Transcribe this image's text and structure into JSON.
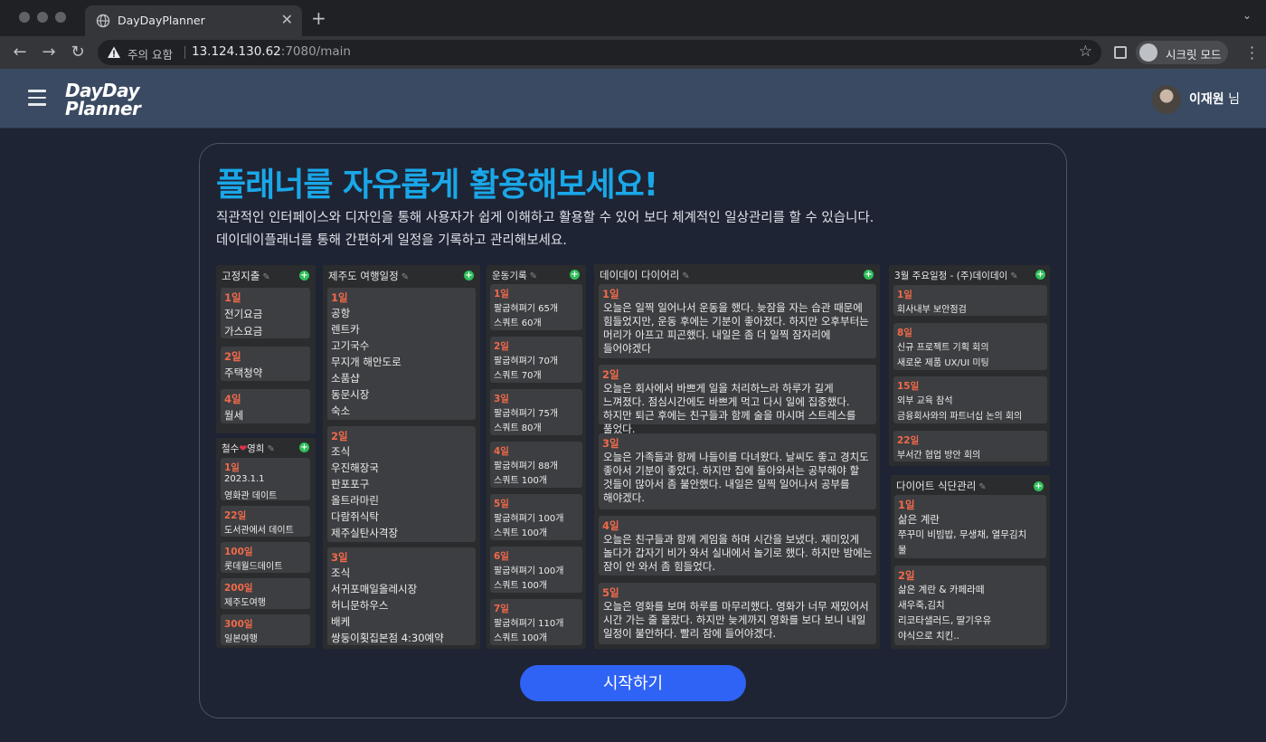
{
  "browser": {
    "tab_title": "DayDayPlanner",
    "security_label": "주의 요함",
    "host": "13.124.130.62",
    "path": ":7080/main",
    "incognito_label": "시크릿 모드"
  },
  "header": {
    "logo_line1": "DayDay",
    "logo_line2": "Planner",
    "user_name": "이재원",
    "user_suffix": " 님"
  },
  "intro": {
    "headline": "플래너를 자유롭게 활용해보세요!",
    "desc1": "직관적인 인터페이스와 디자인을 통해 사용자가 쉽게 이해하고 활용할 수 있어 보다 체계적인 일상관리를 할 수 있습니다.",
    "desc2": "데이데이플래너를 통해 간편하게 일정을 기록하고 관리해보세요."
  },
  "planners": {
    "fixed": {
      "title": "고정지출",
      "entries": [
        {
          "day": "1일",
          "lines": [
            "전기요금",
            "가스요금"
          ]
        },
        {
          "day": "2일",
          "lines": [
            "주택청약"
          ]
        },
        {
          "day": "4일",
          "lines": [
            "월세"
          ]
        }
      ]
    },
    "couple": {
      "title_a": "철수",
      "title_b": "영희",
      "entries": [
        {
          "day": "1일",
          "lines": [
            "2023.1.1",
            "영화관 데이트"
          ]
        },
        {
          "day": "22일",
          "lines": [
            "도서관에서 데이트"
          ]
        },
        {
          "day": "100일",
          "lines": [
            "롯데월드데이트"
          ]
        },
        {
          "day": "200일",
          "lines": [
            "제주도여행"
          ]
        },
        {
          "day": "300일",
          "lines": [
            "일본여행"
          ]
        }
      ]
    },
    "jeju": {
      "title": "제주도 여행일정",
      "entries": [
        {
          "day": "1일",
          "lines": [
            "공항",
            "렌트카",
            "고기국수",
            "무지개 해안도로",
            "소품샵",
            "동문시장",
            "숙소"
          ]
        },
        {
          "day": "2일",
          "lines": [
            "조식",
            "우진해장국",
            "판포포구",
            "올트라마린",
            "다람쥐식탁",
            "제주실탄사격장"
          ]
        },
        {
          "day": "3일",
          "lines": [
            "조식",
            "서귀포매일올레시장",
            "허니문하우스",
            "배케",
            "쌍둥이횟집본점 4:30예약"
          ]
        }
      ]
    },
    "workout": {
      "title": "운동기록",
      "entries": [
        {
          "day": "1일",
          "lines": [
            "팔굽혀펴기 65개",
            "스쿼트 60개"
          ]
        },
        {
          "day": "2일",
          "lines": [
            "팔굽혀펴기 70개",
            "스쿼트 70개"
          ]
        },
        {
          "day": "3일",
          "lines": [
            "팔굽혀펴기 75개",
            "스쿼트 80개"
          ]
        },
        {
          "day": "4일",
          "lines": [
            "팔굽혀펴기 88개",
            "스쿼트 100개"
          ]
        },
        {
          "day": "5일",
          "lines": [
            "팔굽혀펴기 100개",
            "스쿼트 100개"
          ]
        },
        {
          "day": "6일",
          "lines": [
            "팔굽혀펴기 100개",
            "스쿼트 100개"
          ]
        },
        {
          "day": "7일",
          "lines": [
            "팔굽혀펴기 110개",
            "스쿼트 100개"
          ]
        }
      ]
    },
    "diary": {
      "title": "데이데이 다이어리",
      "entries": [
        {
          "day": "1일",
          "text": "오늘은 일찍 일어나서 운동을 했다. 늦잠을 자는 습관 때문에 힘들었지만, 운동 후에는 기분이 좋아졌다. 하지만 오후부터는 머리가 아프고 피곤했다. 내일은 좀 더 일찍 잠자리에 들어야겠다"
        },
        {
          "day": "2일",
          "text": "오늘은 회사에서 바쁘게 일을 처리하느라 하루가 길게 느껴졌다. 점심시간에도 바쁘게 먹고 다시 일에 집중했다. 하지만 퇴근 후에는 친구들과 함께 술을 마시며 스트레스를 풀었다."
        },
        {
          "day": "3일",
          "text": "오늘은 가족들과 함께 나들이를 다녀왔다. 날씨도 좋고 경치도 좋아서 기분이 좋았다. 하지만 집에 돌아와서는 공부해야 할 것들이 많아서 좀 불안했다. 내일은 일찍 일어나서 공부를 해야겠다."
        },
        {
          "day": "4일",
          "text": "오늘은 친구들과 함께 게임을 하며 시간을 보냈다. 재미있게 놀다가 갑자기 비가 와서 실내에서 놀기로 했다. 하지만 밤에는 잠이 안 와서 좀 힘들었다."
        },
        {
          "day": "5일",
          "text": "오늘은 영화를 보며 하루를 마무리했다. 영화가 너무 재밌어서 시간 가는 줄 몰랐다. 하지만 늦게까지 영화를 보다 보니 내일 일정이 불안하다. 빨리 잠에 들어야겠다."
        }
      ]
    },
    "march": {
      "title": "3월 주요일정 - (주)데이데이",
      "entries": [
        {
          "day": "1일",
          "lines": [
            "회사내부 보안점검"
          ]
        },
        {
          "day": "8일",
          "lines": [
            "신규 프로젝트 기획 회의",
            "새로운 제품 UX/UI 미팅"
          ]
        },
        {
          "day": "15일",
          "lines": [
            "외부 교육 참석",
            "금융회사와의 파트너십 논의 회의"
          ]
        },
        {
          "day": "22일",
          "lines": [
            "부서간 협업 방안 회의"
          ]
        }
      ]
    },
    "diet": {
      "title": "다이어트 식단관리",
      "entries": [
        {
          "day": "1일",
          "lines": [
            "삶은 계란",
            "쭈꾸미 비빔밥, 무생채, 열무김치",
            "물"
          ]
        },
        {
          "day": "2일",
          "lines": [
            "삶은 계란 & 카페라떼",
            "새우죽,김치",
            "리코타샐러드, 딸기우유",
            "야식으로 치킨.."
          ]
        }
      ]
    }
  },
  "cta": {
    "label": "시작하기"
  },
  "colors": {
    "accent_title": "#1aa7e8",
    "day_label": "#f06a4a",
    "cta": "#2f63f5",
    "add_button": "#2fbf5a"
  }
}
